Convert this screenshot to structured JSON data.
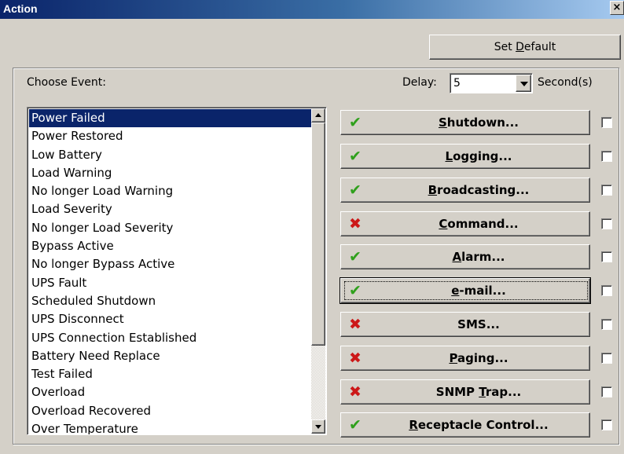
{
  "window": {
    "title": "Action",
    "close_glyph": "×"
  },
  "toolbar": {
    "set_default": {
      "pre": "Set ",
      "u": "D",
      "post": "efault"
    }
  },
  "choose_event_label": "Choose Event:",
  "delay": {
    "label": "Delay:",
    "value": "5",
    "unit": "Second(s)"
  },
  "events": [
    "Power Failed",
    "Power Restored",
    "Low Battery",
    "Load Warning",
    "No longer Load Warning",
    "Load Severity",
    "No longer Load Severity",
    "Bypass Active",
    "No longer Bypass Active",
    "UPS Fault",
    "Scheduled Shutdown",
    "UPS Disconnect",
    "UPS Connection Established",
    "Battery Need Replace",
    "Test Failed",
    "Overload",
    "Overload Recovered",
    "Over Temperature"
  ],
  "selected_event": "Power Failed",
  "actions": [
    {
      "pre": "",
      "u": "S",
      "post": "hutdown...",
      "status": "check-icon",
      "glyph": "✔",
      "enabled": true,
      "checked": false
    },
    {
      "pre": "",
      "u": "L",
      "post": "ogging...",
      "status": "check-icon",
      "glyph": "✔",
      "enabled": true,
      "checked": false
    },
    {
      "pre": "",
      "u": "B",
      "post": "roadcasting...",
      "status": "check-icon",
      "glyph": "✔",
      "enabled": true,
      "checked": false
    },
    {
      "pre": "",
      "u": "C",
      "post": "ommand...",
      "status": "cross-icon",
      "glyph": "✖",
      "enabled": false,
      "checked": false
    },
    {
      "pre": "",
      "u": "A",
      "post": "larm...",
      "status": "check-icon",
      "glyph": "✔",
      "enabled": true,
      "checked": false
    },
    {
      "pre": "",
      "u": "e",
      "post": "-mail...",
      "status": "check-icon",
      "glyph": "✔",
      "enabled": true,
      "checked": false,
      "focused": true
    },
    {
      "pre": "SMS...",
      "u": "",
      "post": "",
      "status": "cross-icon",
      "glyph": "✖",
      "enabled": false,
      "checked": false
    },
    {
      "pre": "",
      "u": "P",
      "post": "aging...",
      "status": "cross-icon",
      "glyph": "✖",
      "enabled": false,
      "checked": false
    },
    {
      "pre": "SNMP ",
      "u": "T",
      "post": "rap...",
      "status": "cross-icon",
      "glyph": "✖",
      "enabled": false,
      "checked": false
    },
    {
      "pre": "",
      "u": "R",
      "post": "eceptacle Control...",
      "status": "check-icon",
      "glyph": "✔",
      "enabled": true,
      "checked": false
    }
  ],
  "colors": {
    "title_gradient_start": "#0a246a",
    "title_gradient_end": "#a6caf0",
    "check": "#2fa01c",
    "cross": "#cc1818",
    "selection": "#0a246a",
    "face": "#d4d0c8"
  }
}
